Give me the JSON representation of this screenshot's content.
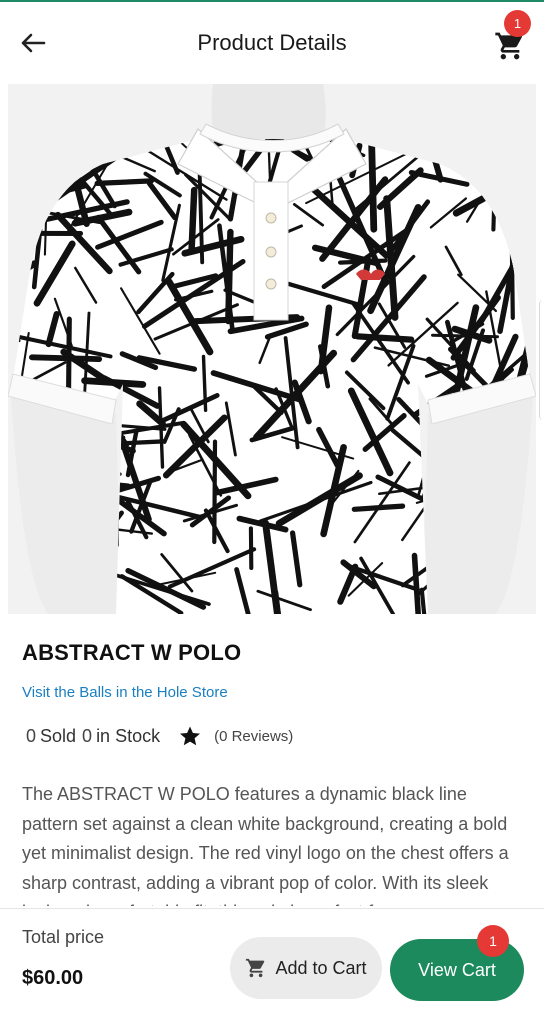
{
  "appbar": {
    "title": "Product Details",
    "cart_count": "1",
    "icons": {
      "back": "arrow-left-icon",
      "cart": "shopping-cart-icon"
    }
  },
  "product": {
    "image_alt": "Black and white abstract line pattern polo shirt on mannequin",
    "name": "ABSTRACT W POLO",
    "store_link": "Visit the Balls in the Hole Store",
    "sold_count": "0",
    "sold_label": "Sold",
    "stock_count": "0",
    "stock_label": "in Stock",
    "reviews": "(0 Reviews)",
    "description": "The ABSTRACT W POLO features a dynamic black line pattern set against a clean white background, creating a bold yet minimalist design. The red vinyl logo on the chest offers a sharp contrast, adding a vibrant pop of color. With its sleek look and comfortable fit, this polo is perfect for"
  },
  "footer": {
    "total_label": "Total price",
    "total_value": "$60.00",
    "add_to_cart_label": "Add to Cart",
    "view_cart_label": "View Cart",
    "view_cart_count": "1"
  },
  "colors": {
    "accent": "#1c8a5d",
    "badge": "#e53935",
    "link": "#1a7fc0"
  }
}
